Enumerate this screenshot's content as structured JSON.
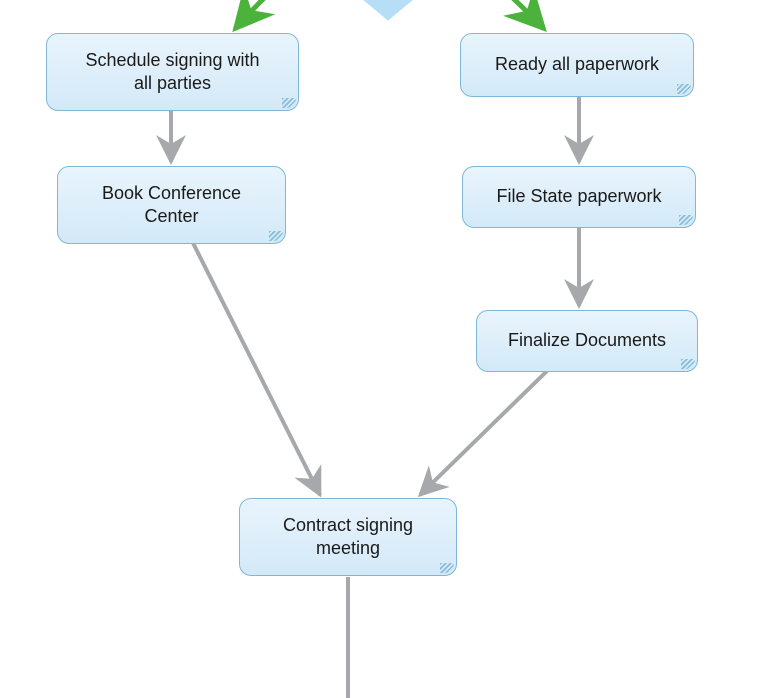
{
  "nodes": {
    "schedule": {
      "label": "Schedule signing with\nall parties"
    },
    "bookconf": {
      "label": "Book Conference\nCenter"
    },
    "readypw": {
      "label": "Ready all paperwork"
    },
    "filestate": {
      "label": "File State paperwork"
    },
    "finalize": {
      "label": "Finalize Documents"
    },
    "meeting": {
      "label": "Contract signing\nmeeting"
    }
  },
  "colors": {
    "node_border": "#7fb8d6",
    "node_fill_top": "#e9f4fc",
    "node_fill_bottom": "#d3e9f8",
    "arrow_gray": "#a6a8ab",
    "arrow_green": "#4bb23b",
    "diamond": "#b7def7"
  },
  "diagram": {
    "edges": [
      {
        "from": "top-gateway",
        "to": "schedule",
        "color": "green"
      },
      {
        "from": "top-gateway",
        "to": "readypw",
        "color": "green"
      },
      {
        "from": "schedule",
        "to": "bookconf",
        "color": "gray"
      },
      {
        "from": "readypw",
        "to": "filestate",
        "color": "gray"
      },
      {
        "from": "filestate",
        "to": "finalize",
        "color": "gray"
      },
      {
        "from": "bookconf",
        "to": "meeting",
        "color": "gray"
      },
      {
        "from": "finalize",
        "to": "meeting",
        "color": "gray"
      },
      {
        "from": "meeting",
        "to": "bottom",
        "color": "gray"
      }
    ]
  }
}
